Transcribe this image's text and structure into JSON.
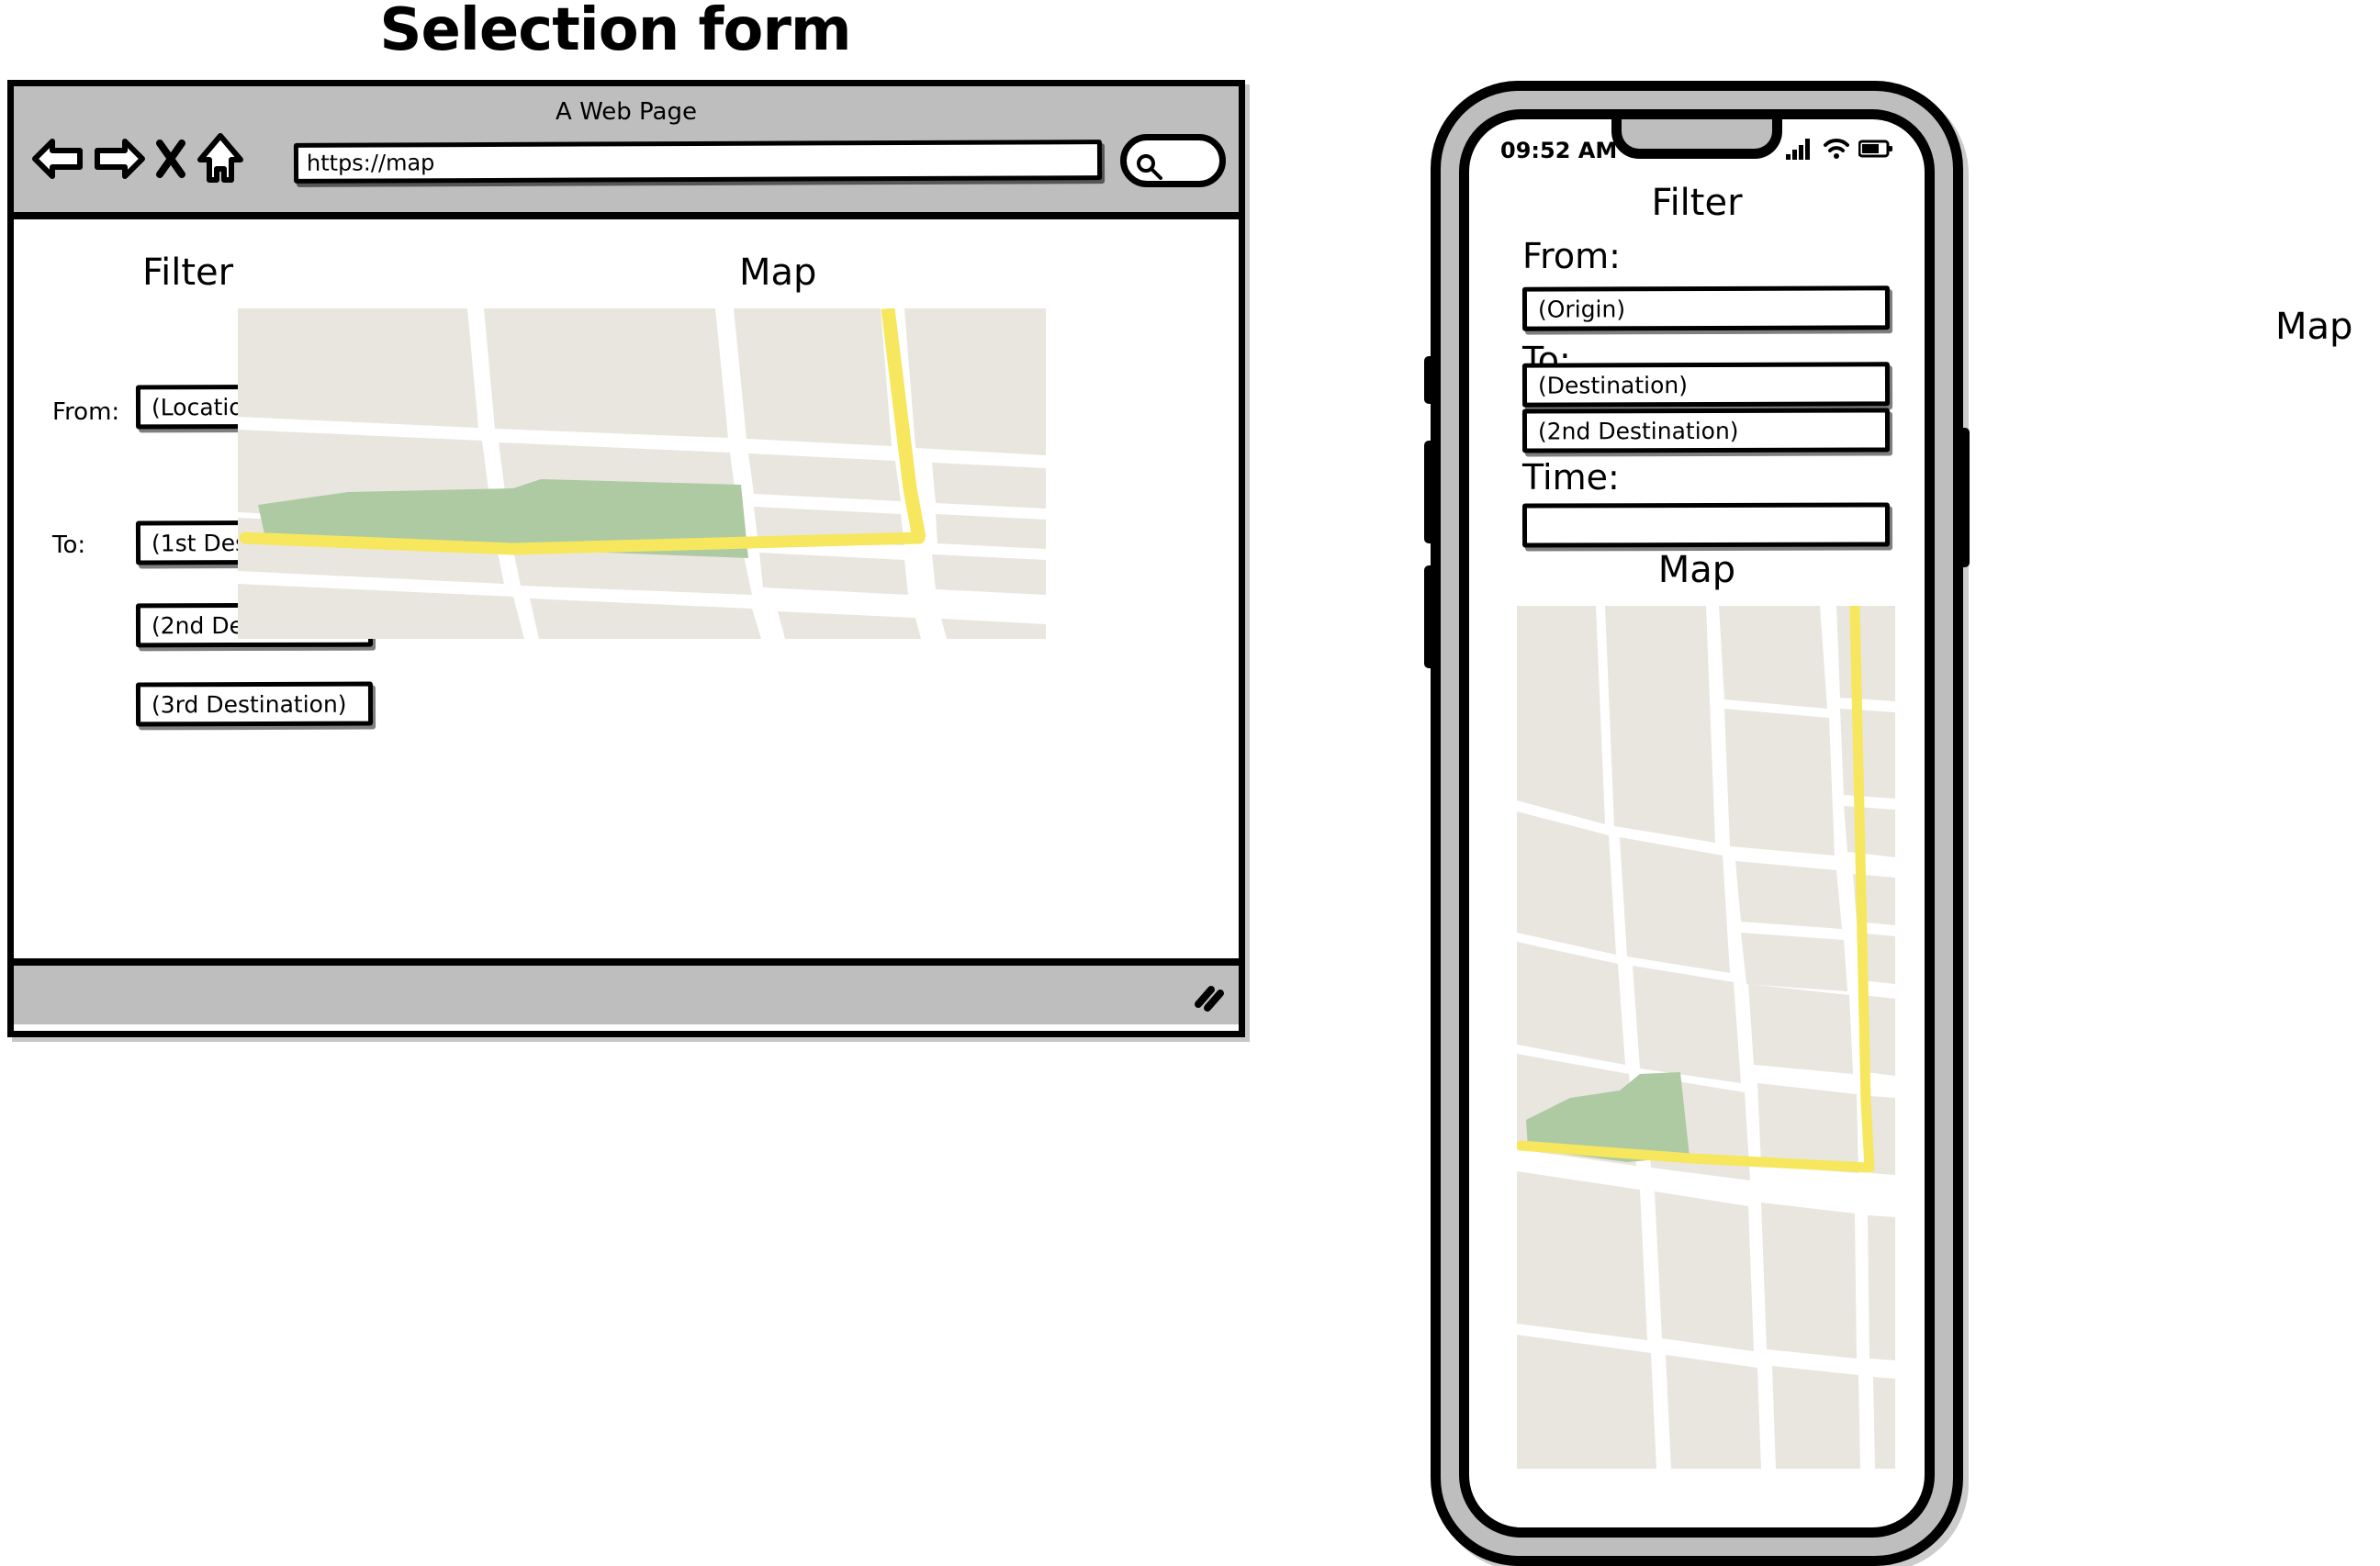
{
  "page": {
    "title": "Selection form",
    "stray_map_label": "Map"
  },
  "browser": {
    "window_title": "A Web Page",
    "url_value": "https://map",
    "url_placeholder": "https://map",
    "nav": {
      "back_icon": "arrow-left-icon",
      "forward_icon": "arrow-right-icon",
      "stop_icon": "close-icon",
      "home_icon": "home-icon",
      "search_icon": "search-icon"
    },
    "resize_handle_icon": "resize-grip-icon"
  },
  "desktop_form": {
    "filter_heading": "Filter",
    "map_heading": "Map",
    "from_label": "From:",
    "from_value": "(Location)",
    "from_placeholder": "(Location)",
    "to_label": "To:",
    "destinations": [
      {
        "value": "(1st Destination)",
        "placeholder": "(1st Destination)"
      },
      {
        "value": "(2nd Destination)",
        "placeholder": "(2nd Destination)"
      },
      {
        "value": "(3rd Destination)",
        "placeholder": "(3rd Destination)"
      }
    ]
  },
  "phone": {
    "status": {
      "time": "09:52 AM",
      "signal_icon": "cellular-signal-icon",
      "wifi_icon": "wifi-icon",
      "battery_icon": "battery-icon"
    },
    "title": "Filter",
    "from_label": "From:",
    "from_value": "(Origin)",
    "from_placeholder": "(Origin)",
    "to_label": "To:",
    "destinations": [
      {
        "value": "(Destination)",
        "placeholder": "(Destination)"
      },
      {
        "value": "(2nd Destination)",
        "placeholder": "(2nd Destination)"
      }
    ],
    "time_label": "Time:",
    "time_value": "",
    "time_placeholder": "",
    "map_heading": "Map"
  },
  "map_colors": {
    "block": "#e9e6df",
    "road": "#ffffff",
    "highway": "#f6e75e",
    "park": "#aecaa2"
  }
}
